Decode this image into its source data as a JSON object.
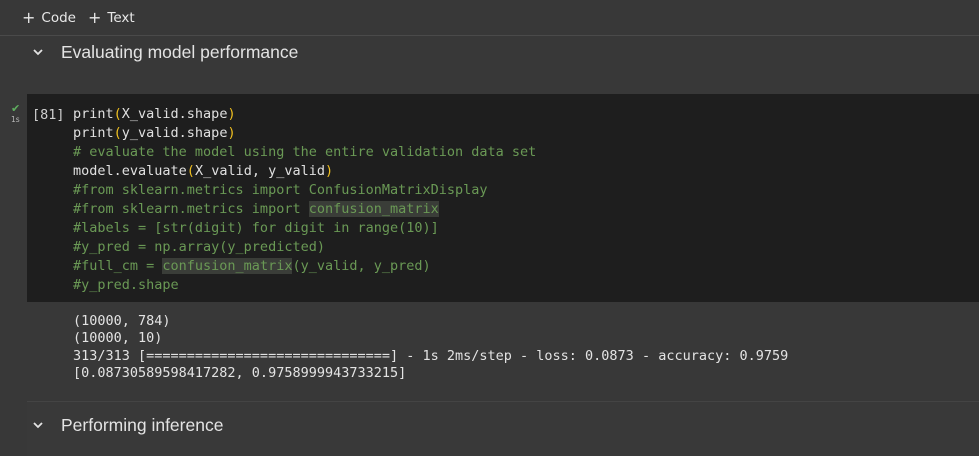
{
  "toolbar": {
    "add_code_label": "Code",
    "add_text_label": "Text"
  },
  "sections": {
    "evaluating_title": "Evaluating model performance",
    "inference_title": "Performing inference"
  },
  "cell": {
    "prompt": "[81]",
    "exec_time": "1s",
    "code_lines": [
      [
        {
          "t": "print",
          "c": "fn"
        },
        {
          "t": "(",
          "c": "paren"
        },
        {
          "t": "X_valid.shape",
          "c": "fn"
        },
        {
          "t": ")",
          "c": "paren"
        }
      ],
      [
        {
          "t": "print",
          "c": "fn"
        },
        {
          "t": "(",
          "c": "paren"
        },
        {
          "t": "y_valid.shape",
          "c": "fn"
        },
        {
          "t": ")",
          "c": "paren"
        }
      ],
      [
        {
          "t": "# evaluate the model using the entire validation data set",
          "c": "comment"
        }
      ],
      [
        {
          "t": "model.evaluate",
          "c": "fn"
        },
        {
          "t": "(",
          "c": "paren"
        },
        {
          "t": "X_valid, y_valid",
          "c": "fn"
        },
        {
          "t": ")",
          "c": "paren"
        }
      ],
      [
        {
          "t": "#from sklearn.metrics import ConfusionMatrixDisplay",
          "c": "comment"
        }
      ],
      [
        {
          "t": "#from sklearn.metrics import ",
          "c": "comment"
        },
        {
          "t": "confusion_matrix",
          "c": "comment hl"
        }
      ],
      [
        {
          "t": "#labels = [str(digit) for digit in range(10)]",
          "c": "comment"
        }
      ],
      [
        {
          "t": "#y_pred = np.array(y_predicted)",
          "c": "comment"
        }
      ],
      [
        {
          "t": "#full_cm = ",
          "c": "comment"
        },
        {
          "t": "confusion_matrix",
          "c": "comment hl"
        },
        {
          "t": "(y_valid, y_pred)",
          "c": "comment"
        }
      ],
      [
        {
          "t": "#y_pred.shape",
          "c": "comment"
        }
      ]
    ],
    "output_lines": [
      "(10000, 784)",
      "(10000, 10)",
      "313/313 [==============================] - 1s 2ms/step - loss: 0.0873 - accuracy: 0.9759",
      "[0.08730589598417282, 0.9758999943733215]"
    ]
  },
  "colors": {
    "background": "#383838",
    "cell_background": "#1e1e1e",
    "comment": "#6a9955",
    "paren": "#f0c020",
    "success_check": "#5fae5f"
  }
}
